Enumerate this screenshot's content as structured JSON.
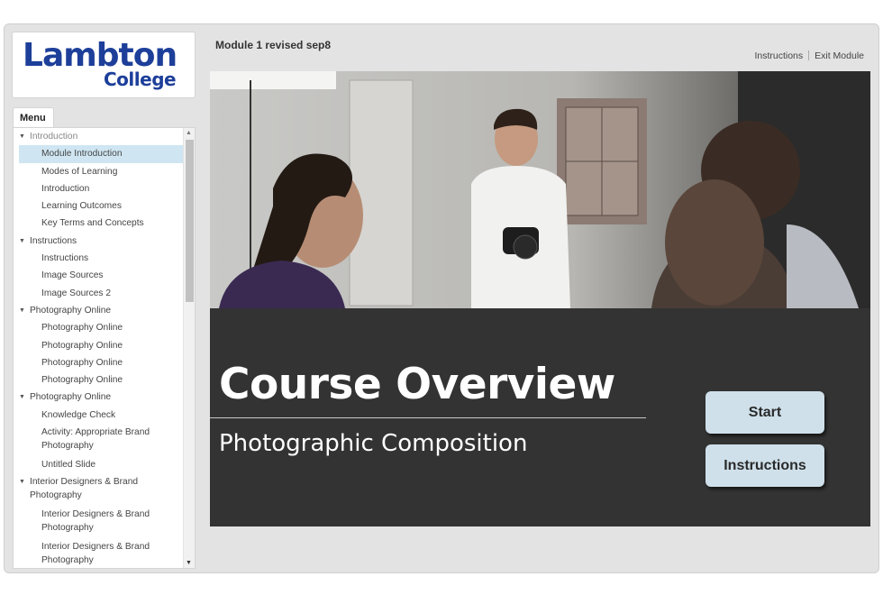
{
  "logo": {
    "line1": "Lambton",
    "line2": "College"
  },
  "menu": {
    "tab_label": "Menu",
    "items": [
      {
        "label": "Introduction",
        "level": "top",
        "style": "dim"
      },
      {
        "label": "Module Introduction",
        "level": "sub",
        "style": "active"
      },
      {
        "label": "Modes of Learning",
        "level": "sub"
      },
      {
        "label": "Introduction",
        "level": "sub"
      },
      {
        "label": "Learning Outcomes",
        "level": "sub"
      },
      {
        "label": "Key Terms and Concepts",
        "level": "sub"
      },
      {
        "label": "Instructions",
        "level": "top"
      },
      {
        "label": "Instructions",
        "level": "sub"
      },
      {
        "label": "Image Sources",
        "level": "sub"
      },
      {
        "label": "Image Sources 2",
        "level": "sub"
      },
      {
        "label": "Photography Online",
        "level": "top"
      },
      {
        "label": "Photography Online",
        "level": "sub"
      },
      {
        "label": "Photography Online",
        "level": "sub"
      },
      {
        "label": "Photography Online",
        "level": "sub"
      },
      {
        "label": "Photography Online",
        "level": "sub"
      },
      {
        "label": "Photography Online",
        "level": "top"
      },
      {
        "label": "Knowledge Check",
        "level": "sub"
      },
      {
        "label": "Activity: Appropriate Brand",
        "level": "sub",
        "wrap": 1
      },
      {
        "label": "Photography",
        "level": "sub",
        "wrap": 2
      },
      {
        "label": "Untitled Slide",
        "level": "sub"
      },
      {
        "label": "Interior Designers & Brand",
        "level": "top",
        "wrap": 1
      },
      {
        "label": "Photography",
        "level": "cont",
        "wrap": 2
      },
      {
        "label": "Interior Designers & Brand",
        "level": "sub",
        "wrap": 1
      },
      {
        "label": "Photography",
        "level": "sub",
        "wrap": 2
      },
      {
        "label": "Interior Designers & Brand",
        "level": "sub",
        "wrap": 1
      },
      {
        "label": "Photography",
        "level": "sub",
        "wrap": 2
      }
    ]
  },
  "header": {
    "module_title": "Module 1 revised sep8",
    "links": [
      "Instructions",
      "Exit Module"
    ]
  },
  "slide": {
    "title": "Course Overview",
    "subtitle": "Photographic Composition",
    "start_label": "Start",
    "instructions_label": "Instructions",
    "photo_description_icon": "photographer-studio-image"
  },
  "colors": {
    "logo_blue": "#1d3f9a",
    "slide_bg": "#333333",
    "button_bg": "#cfe0ea",
    "active_item_bg": "#cfe6f2"
  }
}
